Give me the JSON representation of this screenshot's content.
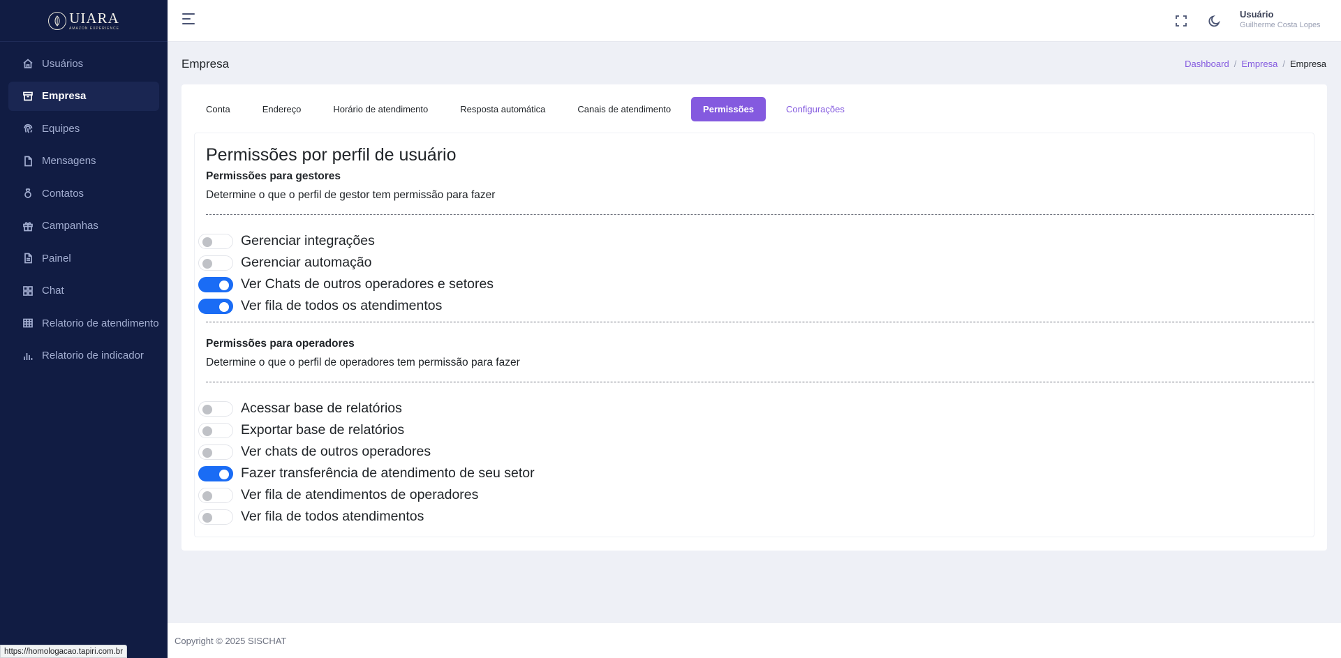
{
  "app": {
    "logo_text": "UIARA",
    "logo_subtext": "AMAZON EXPERIENCE"
  },
  "sidebar": {
    "items": [
      {
        "label": "Usuários",
        "icon": "home-icon",
        "active": false
      },
      {
        "label": "Empresa",
        "icon": "archive-icon",
        "active": true
      },
      {
        "label": "Equipes",
        "icon": "fingerprint-icon",
        "active": false
      },
      {
        "label": "Mensagens",
        "icon": "file-icon",
        "active": false
      },
      {
        "label": "Contatos",
        "icon": "medal-icon",
        "active": false
      },
      {
        "label": "Campanhas",
        "icon": "gift-icon",
        "active": false
      },
      {
        "label": "Painel",
        "icon": "file-text-icon",
        "active": false
      },
      {
        "label": "Chat",
        "icon": "grid-icon",
        "active": false
      },
      {
        "label": "Relatorio de atendimento",
        "icon": "table-icon",
        "active": false
      },
      {
        "label": "Relatorio de indicador",
        "icon": "bar-chart-icon",
        "active": false
      }
    ]
  },
  "header": {
    "user_title": "Usuário",
    "user_name": "Guilherme Costa Lopes",
    "icons": [
      "menu-icon",
      "fullscreen-icon",
      "moon-icon"
    ]
  },
  "page": {
    "title": "Empresa",
    "breadcrumb": {
      "links": [
        "Dashboard",
        "Empresa"
      ],
      "current": "Empresa",
      "separator": "/"
    }
  },
  "tabs": [
    {
      "label": "Conta",
      "state": "normal"
    },
    {
      "label": "Endereço",
      "state": "normal"
    },
    {
      "label": "Horário de atendimento",
      "state": "normal"
    },
    {
      "label": "Resposta automática",
      "state": "normal"
    },
    {
      "label": "Canais de atendimento",
      "state": "normal"
    },
    {
      "label": "Permissões",
      "state": "active"
    },
    {
      "label": "Configurações",
      "state": "accent"
    }
  ],
  "permissions": {
    "title": "Permissões por perfil de usuário",
    "gestores": {
      "title": "Permissões para gestores",
      "description": "Determine o que o perfil de gestor tem permissão para fazer",
      "items": [
        {
          "label": "Gerenciar integrações",
          "enabled": false
        },
        {
          "label": "Gerenciar automação",
          "enabled": false
        },
        {
          "label": "Ver Chats de outros operadores e setores",
          "enabled": true
        },
        {
          "label": "Ver fila de todos os atendimentos",
          "enabled": true
        }
      ]
    },
    "operadores": {
      "title": "Permissões para operadores",
      "description": "Determine o que o perfil de operadores tem permissão para fazer",
      "items": [
        {
          "label": "Acessar base de relatórios",
          "enabled": false
        },
        {
          "label": "Exportar base de relatórios",
          "enabled": false
        },
        {
          "label": "Ver chats de outros operadores",
          "enabled": false
        },
        {
          "label": "Fazer transferência de atendimento de seu setor",
          "enabled": true
        },
        {
          "label": "Ver fila de atendimentos de operadores",
          "enabled": false
        },
        {
          "label": "Ver fila de todos atendimentos",
          "enabled": false
        }
      ]
    }
  },
  "footer": {
    "copyright": "Copyright © 2025 SISCHAT"
  },
  "status_bar": {
    "url": "https://homologacao.tapiri.com.br"
  },
  "colors": {
    "sidebar_bg": "#111c43",
    "primary_purple": "#845adf",
    "toggle_on": "#1a6cf5"
  }
}
